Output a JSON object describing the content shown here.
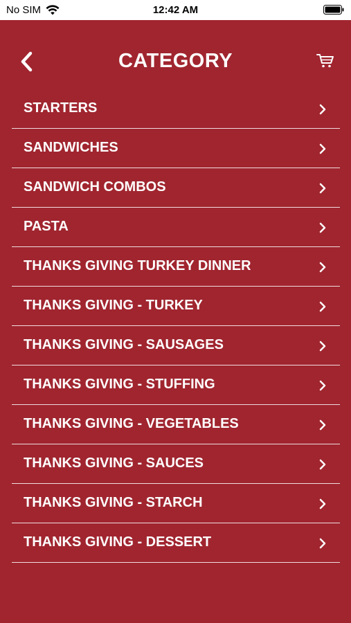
{
  "status_bar": {
    "carrier": "No SIM",
    "time": "12:42 AM",
    "wifi_icon": "wifi-icon",
    "battery_icon": "battery-icon"
  },
  "header": {
    "title": "CATEGORY",
    "back_icon": "chevron-left-icon",
    "cart_icon": "cart-icon"
  },
  "categories": [
    "STARTERS",
    "SANDWICHES",
    "SANDWICH COMBOS",
    "PASTA",
    "THANKS GIVING TURKEY DINNER",
    "THANKS GIVING - TURKEY",
    "THANKS GIVING - SAUSAGES",
    "THANKS GIVING - STUFFING",
    "THANKS GIVING - VEGETABLES",
    "THANKS GIVING - SAUCES",
    "THANKS GIVING - STARCH",
    "THANKS GIVING - DESSERT"
  ],
  "colors": {
    "background": "#a0252f",
    "text": "#ffffff",
    "status_bar": "#ffffff"
  }
}
